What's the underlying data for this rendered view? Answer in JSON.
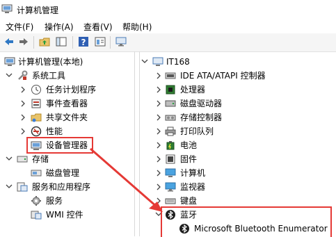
{
  "window": {
    "title": "计算机管理"
  },
  "menu": [
    "文件(F)",
    "操作(A)",
    "查看(V)",
    "帮助(H)"
  ],
  "toolbar": {
    "buttons": [
      "back-arrow-icon",
      "forward-arrow-icon",
      "up-folder-icon",
      "show-hide-tree-icon",
      "help-icon",
      "properties-icon",
      "monitor-icon"
    ]
  },
  "left_tree": {
    "root": "计算机管理(本地)",
    "system_tools": "系统工具",
    "task_scheduler": "任务计划程序",
    "event_viewer": "事件查看器",
    "shared_folders": "共享文件夹",
    "performance": "性能",
    "device_manager": "设备管理器",
    "storage": "存储",
    "disk_management": "磁盘管理",
    "services_apps": "服务和应用程序",
    "services": "服务",
    "wmi": "WMI 控件"
  },
  "right_tree": {
    "root": "IT168",
    "items": [
      "IDE ATA/ATAPI 控制器",
      "处理器",
      "磁盘驱动器",
      "存储控制器",
      "打印队列",
      "电池",
      "固件",
      "计算机",
      "监视器",
      "键盘"
    ],
    "bluetooth": "蓝牙",
    "bluetooth_child": "Microsoft Bluetooth Enumerator"
  },
  "highlight_color": "#e53935"
}
